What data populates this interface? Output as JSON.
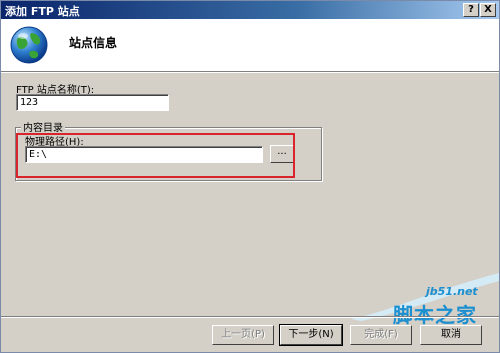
{
  "window": {
    "title": "添加 FTP 站点",
    "help_button": "?",
    "close_button": "X"
  },
  "header": {
    "title": "站点信息",
    "icon": "globe-icon"
  },
  "form": {
    "site_name_label": "FTP 站点名称(T):",
    "site_name_value": "123",
    "content_group_label": "内容目录",
    "physical_path_label": "物理路径(H):",
    "physical_path_value": "E:\\",
    "browse_label": "..."
  },
  "buttons": {
    "prev": "上一页(P)",
    "next": "下一步(N)",
    "finish": "完成(F)",
    "cancel": "取消"
  },
  "watermark": {
    "url": "jb51.net",
    "text": "脚本之家"
  },
  "colors": {
    "titlebar": "#0a246a",
    "highlight": "#d8242a",
    "dialog_bg": "#d4d0c8",
    "watermark": "#1b8fd0"
  }
}
